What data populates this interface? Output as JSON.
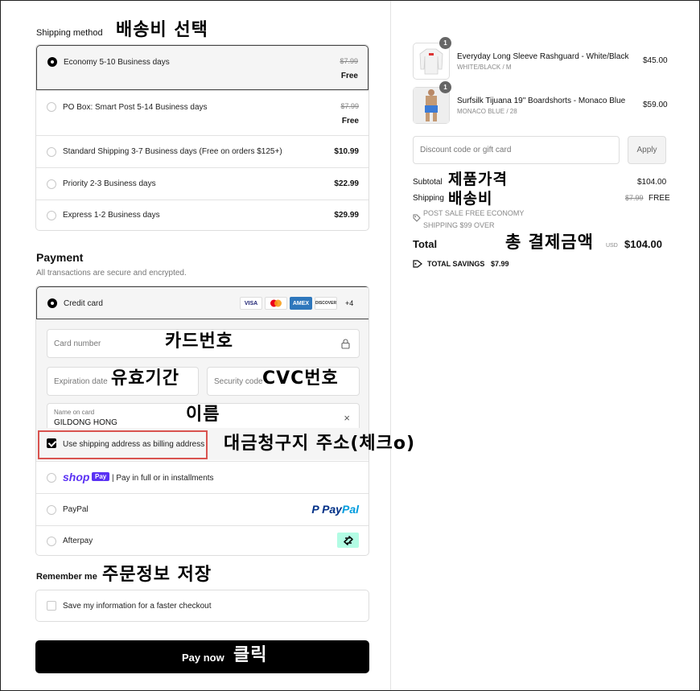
{
  "shipping": {
    "title": "Shipping method",
    "annotation": "배송비 선택",
    "options": [
      {
        "label": "Economy 5-10 Business days",
        "old_price": "$7.99",
        "price": "Free",
        "selected": true
      },
      {
        "label": "PO Box: Smart Post 5-14 Business days",
        "old_price": "$7.99",
        "price": "Free",
        "selected": false
      },
      {
        "label": "Standard Shipping 3-7 Business days (Free on orders $125+)",
        "price": "$10.99",
        "selected": false
      },
      {
        "label": "Priority 2-3 Business days",
        "price": "$22.99",
        "selected": false
      },
      {
        "label": "Express 1-2 Business days",
        "price": "$29.99",
        "selected": false
      }
    ]
  },
  "payment": {
    "title": "Payment",
    "subtitle": "All transactions are secure and encrypted.",
    "credit_card_label": "Credit card",
    "card_logos": [
      "VISA",
      "MC",
      "AMEX",
      "DISCOVER"
    ],
    "more_cards": "+4",
    "card_number_placeholder": "Card number",
    "card_number_annotation": "카드번호",
    "expiration_placeholder": "Expiration date",
    "expiration_annotation": "유효기간",
    "security_placeholder": "Security code",
    "security_annotation": "CVC번호",
    "name_label": "Name on card",
    "name_value": "GILDONG HONG",
    "name_annotation": "이름",
    "billing_label": "Use shipping address as billing address",
    "billing_checked": true,
    "billing_annotation": "대금청구지 주소(체크o)",
    "shop_word": "shop",
    "shop_pay": "Pay",
    "shop_pay_text": "| Pay in full or in installments",
    "paypal_label": "PayPal",
    "paypal_logo_p": "P",
    "paypal_logo_pay": "Pay",
    "paypal_logo_pal": "Pal",
    "afterpay_label": "Afterpay"
  },
  "remember": {
    "title": "Remember me",
    "annotation": "주문정보 저장",
    "save_label": "Save my information for a faster checkout"
  },
  "pay_button": {
    "label": "Pay now",
    "annotation": "클릭"
  },
  "order": {
    "items": [
      {
        "qty": "1",
        "name": "Everyday Long Sleeve Rashguard - White/Black",
        "variant": "WHITE/BLACK / M",
        "price": "$45.00"
      },
      {
        "qty": "1",
        "name": "Surfsilk Tijuana 19\" Boardshorts - Monaco Blue",
        "variant": "MONACO BLUE / 28",
        "price": "$59.00"
      }
    ],
    "discount_placeholder": "Discount code or gift card",
    "apply_label": "Apply",
    "subtotal_label": "Subtotal",
    "subtotal_annotation": "제품가격",
    "subtotal_value": "$104.00",
    "shipping_label": "Shipping",
    "shipping_annotation": "배송비",
    "shipping_old": "$7.99",
    "shipping_value": "FREE",
    "promo_line1": "POST SALE FREE ECONOMY",
    "promo_line2": "SHIPPING $99 OVER",
    "total_label": "Total",
    "total_annotation": "총 결제금액",
    "currency": "USD",
    "total_value": "$104.00",
    "savings_label": "TOTAL SAVINGS",
    "savings_value": "$7.99"
  }
}
